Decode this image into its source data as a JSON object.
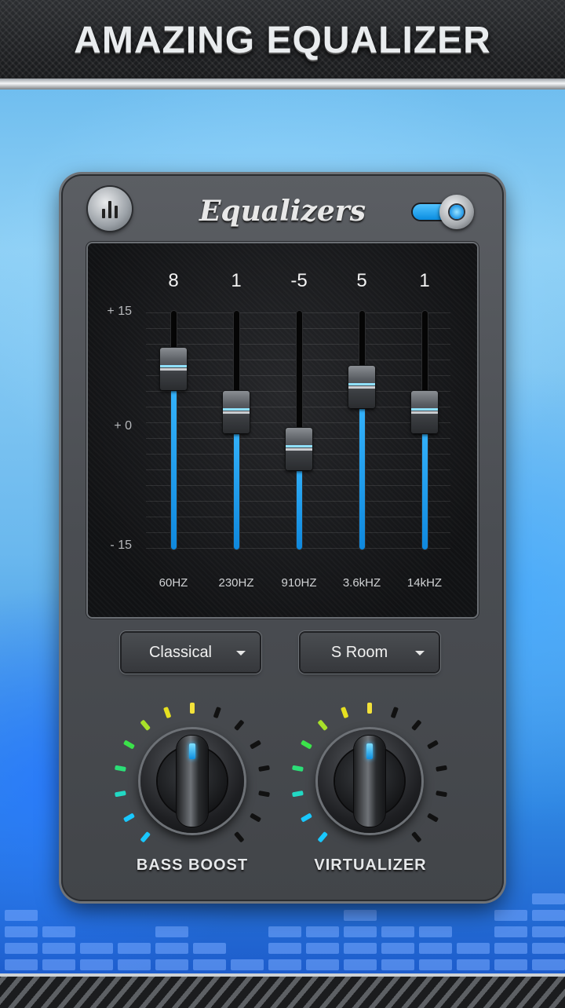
{
  "banner": {
    "title": "AMAZING EQUALIZER"
  },
  "header": {
    "title": "Equalizers",
    "power_on": true
  },
  "eq": {
    "scale": {
      "top": "+ 15",
      "middle": "+ 0",
      "bottom": "- 15",
      "min": -15,
      "max": 15
    },
    "bands": [
      {
        "value": "8",
        "freq": "60HZ"
      },
      {
        "value": "1",
        "freq": "230HZ"
      },
      {
        "value": "-5",
        "freq": "910HZ"
      },
      {
        "value": "5",
        "freq": "3.6kHZ"
      },
      {
        "value": "1",
        "freq": "14kHZ"
      }
    ]
  },
  "preset": {
    "selected": "Classical"
  },
  "reverb": {
    "selected": "S Room"
  },
  "knobs": {
    "bass_boost": {
      "label": "BASS BOOST"
    },
    "virtualizer": {
      "label": "VIRTUALIZER"
    }
  },
  "colors": {
    "accent": "#1ea6f5",
    "panel": "#4d5055",
    "screen": "#151618"
  },
  "icons": {
    "menu": "equalizer-bars-icon",
    "power": "toggle-switch-icon",
    "dropdown": "caret-down-icon"
  }
}
